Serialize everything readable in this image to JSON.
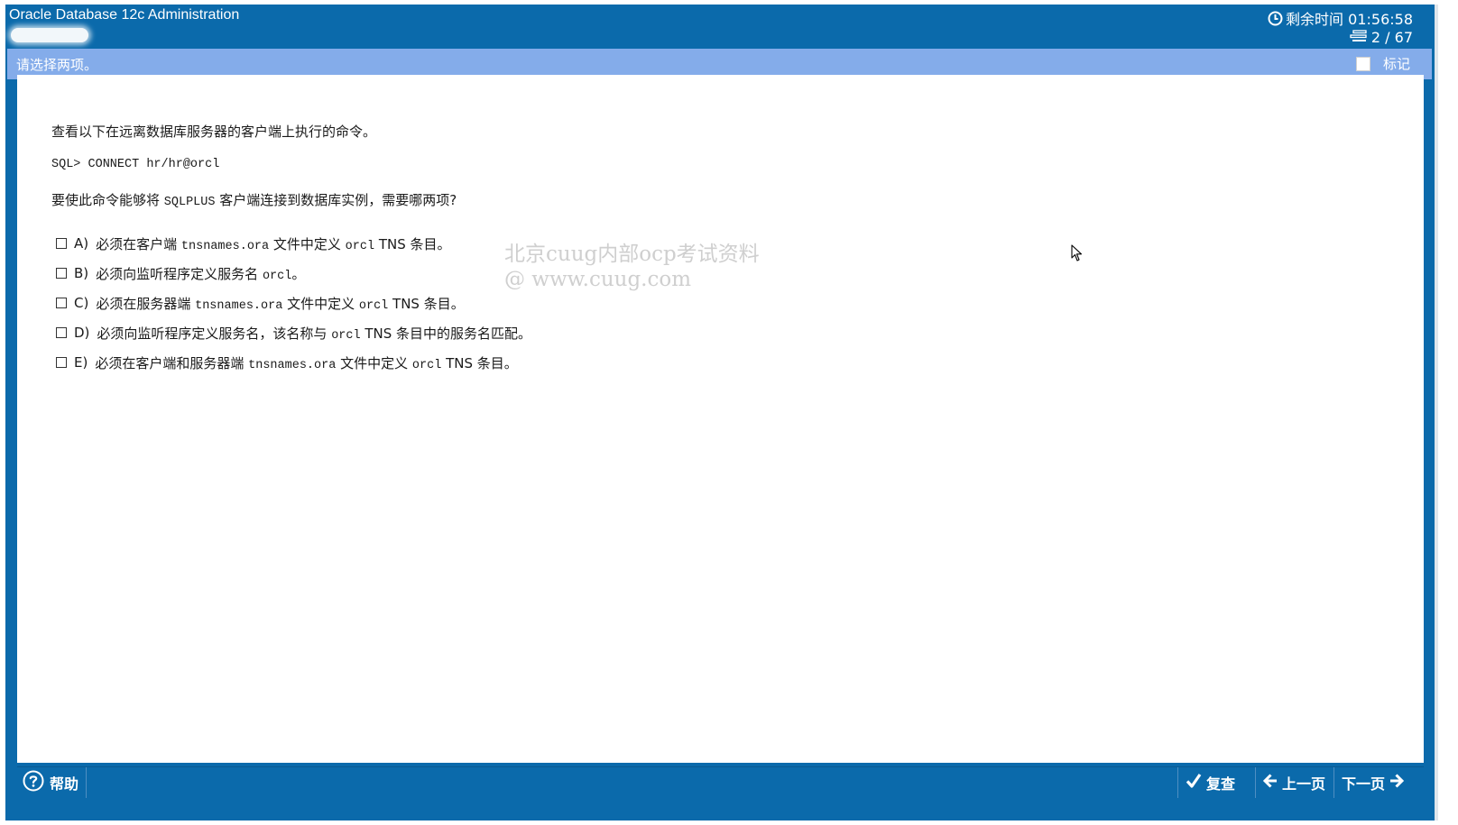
{
  "titlebar": {
    "title": "Oracle Database 12c Administration",
    "timer_label": "剩余时间 01:56:58",
    "counter": "2 / 67"
  },
  "instruction": {
    "text": "请选择两项。",
    "mark_label": "标记",
    "mark_checked": false
  },
  "question": {
    "intro": "查看以下在远离数据库服务器的客户端上执行的命令。",
    "command": "SQL> CONNECT hr/hr@orcl",
    "ask_before": "要使此命令能够将 ",
    "ask_mono": "SQLPLUS",
    "ask_after": " 客户端连接到数据库实例，需要哪两项?",
    "options": [
      {
        "letter": "A)",
        "parts": [
          [
            "t",
            "必须在客户端 "
          ],
          [
            "m",
            "tnsnames.ora"
          ],
          [
            "t",
            " 文件中定义 "
          ],
          [
            "m",
            "orcl"
          ],
          [
            "t",
            " TNS 条目。"
          ]
        ],
        "checked": false
      },
      {
        "letter": "B)",
        "parts": [
          [
            "t",
            "必须向监听程序定义服务名 "
          ],
          [
            "m",
            "orcl"
          ],
          [
            "t",
            "。"
          ]
        ],
        "checked": false
      },
      {
        "letter": "C)",
        "parts": [
          [
            "t",
            "必须在服务器端 "
          ],
          [
            "m",
            "tnsnames.ora"
          ],
          [
            "t",
            " 文件中定义 "
          ],
          [
            "m",
            "orcl"
          ],
          [
            "t",
            " TNS 条目。"
          ]
        ],
        "checked": false
      },
      {
        "letter": "D)",
        "parts": [
          [
            "t",
            "必须向监听程序定义服务名，该名称与 "
          ],
          [
            "m",
            "orcl"
          ],
          [
            "t",
            " TNS 条目中的服务名匹配。"
          ]
        ],
        "checked": false
      },
      {
        "letter": "E)",
        "parts": [
          [
            "t",
            "必须在客户端和服务器端 "
          ],
          [
            "m",
            "tnsnames.ora"
          ],
          [
            "t",
            " 文件中定义 "
          ],
          [
            "m",
            "orcl"
          ],
          [
            "t",
            " TNS 条目。"
          ]
        ],
        "checked": false
      }
    ]
  },
  "watermark": {
    "line1": "北京cuug内部ocp考试资料",
    "line2": "@ www.cuug.com"
  },
  "bottombar": {
    "help_label": "帮助",
    "review_label": "复查",
    "prev_label": "上一页",
    "next_label": "下一页"
  },
  "colors": {
    "frame_blue": "#0b6aab",
    "instruction_bar": "#84acea",
    "watermark": "#cfcfcf"
  }
}
